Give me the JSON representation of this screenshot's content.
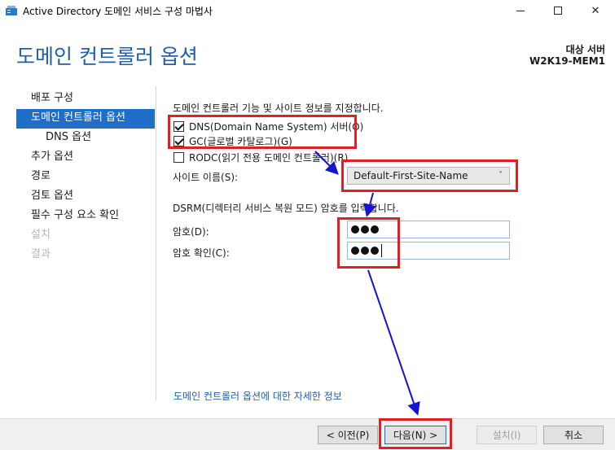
{
  "window": {
    "title": "Active Directory 도메인 서비스 구성 마법사",
    "minimize_icon": "minimize-icon",
    "maximize_icon": "maximize-icon",
    "close_icon": "close-icon",
    "close_glyph": "✕"
  },
  "header": {
    "page_title": "도메인 컨트롤러 옵션",
    "target_label": "대상 서버",
    "target_name": "W2K19-MEM1"
  },
  "nav": {
    "items": [
      {
        "label": "배포 구성",
        "state": "normal"
      },
      {
        "label": "도메인 컨트롤러 옵션",
        "state": "active"
      },
      {
        "label": "DNS 옵션",
        "state": "sub"
      },
      {
        "label": "추가 옵션",
        "state": "normal"
      },
      {
        "label": "경로",
        "state": "normal"
      },
      {
        "label": "검토 옵션",
        "state": "normal"
      },
      {
        "label": "필수 구성 요소 확인",
        "state": "normal"
      },
      {
        "label": "설치",
        "state": "disabled"
      },
      {
        "label": "결과",
        "state": "disabled"
      }
    ]
  },
  "main": {
    "intro": "도메인 컨트롤러 기능 및 사이트 정보를 지정합니다.",
    "checkboxes": [
      {
        "label": "DNS(Domain Name System) 서버(O)",
        "checked": true
      },
      {
        "label": "GC(글로벌 카탈로그)(G)",
        "checked": true
      },
      {
        "label": "RODC(읽기 전용 도메인 컨트롤러)(R)",
        "checked": false
      }
    ],
    "site_label": "사이트 이름(S):",
    "site_value": "Default-First-Site-Name",
    "site_chevron": "˅",
    "dsrm_intro": "DSRM(디렉터리 서비스 복원 모드) 암호를 입력합니다.",
    "password_label": "암호(D):",
    "password_length": 3,
    "confirm_label": "암호 확인(C):",
    "confirm_length": 3,
    "help_link": "도메인 컨트롤러 옵션에 대한 자세한 정보"
  },
  "footer": {
    "prev": "< 이전(P)",
    "next": "다음(N) >",
    "install": "설치(I)",
    "cancel": "취소"
  },
  "colors": {
    "accent": "#1f6fc8",
    "title": "#1f5fa8",
    "annotation_box": "#e41e25",
    "annotation_arrow": "#1414d2"
  }
}
